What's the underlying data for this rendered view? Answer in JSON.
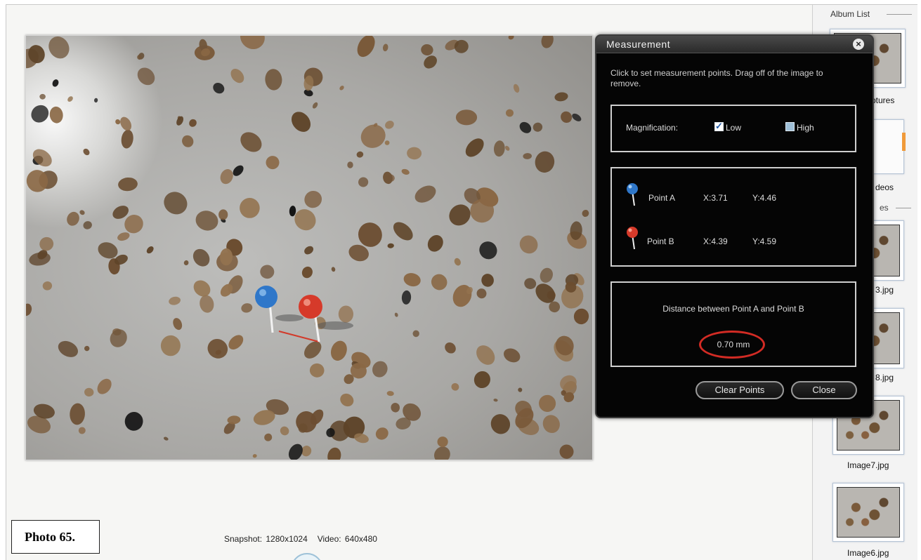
{
  "status": {
    "snapshot": "Snapshot: 1280x1024",
    "video": "Video: 640x480"
  },
  "caption": "Photo 65.",
  "sidebar": {
    "title": "Album List",
    "pictures_label": "ptures",
    "videos_label": "deos",
    "images_label": "es",
    "items": [
      {
        "label": "3.jpg"
      },
      {
        "label": "8.jpg"
      },
      {
        "label": "Image7.jpg"
      },
      {
        "label": "Image6.jpg"
      }
    ]
  },
  "measurement": {
    "title": "Measurement",
    "instructions": "Click to set measurement points. Drag off of the image to remove.",
    "magnification_label": "Magnification:",
    "low_label": "Low",
    "high_label": "High",
    "low_checked": true,
    "high_checked": false,
    "point_a": {
      "name": "Point A",
      "x": "X:3.71",
      "y": "Y:4.46",
      "color": "#2f77c9"
    },
    "point_b": {
      "name": "Point B",
      "x": "X:4.39",
      "y": "Y:4.59",
      "color": "#d63a2a"
    },
    "distance_label": "Distance between Point A and Point B",
    "distance_value": "0.70 mm",
    "clear_button": "Clear Points",
    "close_button": "Close"
  }
}
